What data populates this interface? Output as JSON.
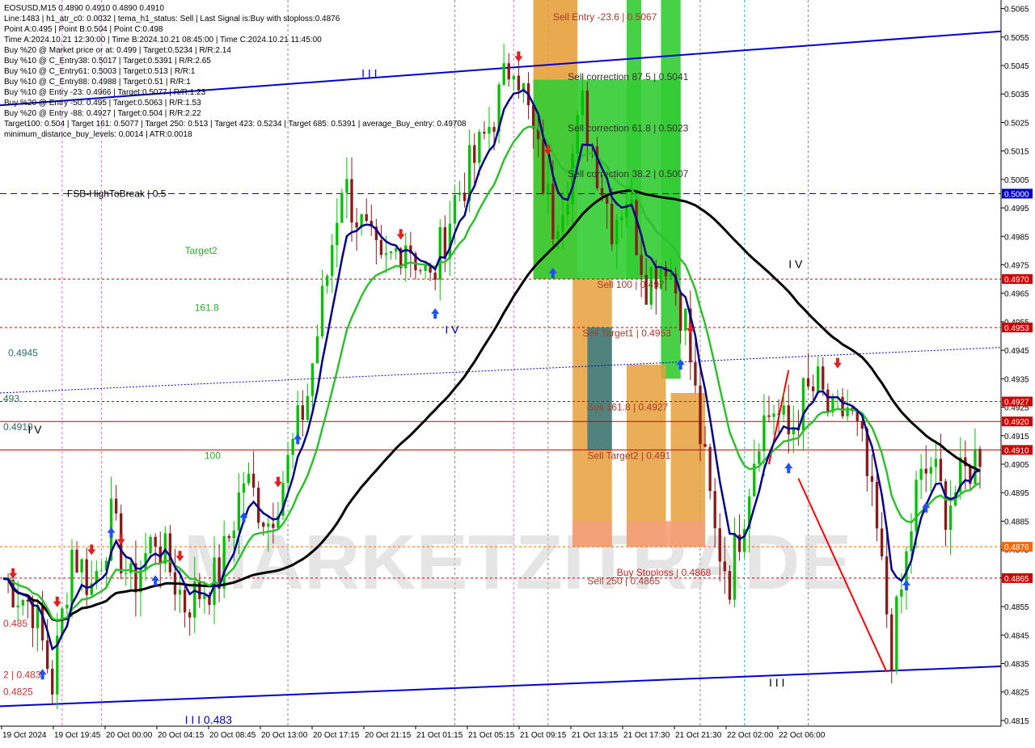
{
  "header": {
    "lines": [
      "EOSUSD,M15  0.4890 0.4910 0.4890 0.4910",
      "Line:1483  |  h1_atr_c0: 0.0032  |  tema_h1_status: Sell  |  Last Signal is:Buy with stoploss:0.4876",
      "Point A:0.495  |  Point B:0.504  |  Point C:0.498",
      "Time A:2024.10.21 12:30:00  |  Time B:2024.10.21 08:45:00  |  Time C:2024.10.21 11:45:00",
      "Buy %20 @ Market price or at: 0.499  |  Target:0.5234  |  R/R:2.14",
      "Buy %10 @ C_Entry38: 0.5017  |  Target:0.5391  |  R/R:2.65",
      "Buy %10 @ C_Entry61: 0.5003  |  Target:0.513  |  R/R:1",
      "Buy %10 @ C_Entry88: 0.4988  |  Target:0.51  |  R/R:1",
      "Buy %10 @ Entry -23: 0.4966  |  Target:0.5077  |  R/R:1.23",
      "Buy %20 @ Entry -50: 0.495  |  Target:0.5063  |  R/R:1.53",
      "Buy %20 @ Entry -88: 0.4927  |  Target:0.504  |  R/R:2.22",
      "Target100: 0.504  |  Target 161: 0.5077  |  Target 250: 0.513  |  Target 423: 0.5234  |  Target 685: 0.5391  |  average_Buy_entry: 0.49708",
      "minimum_distance_buy_levels: 0.0014  |  ATR:0.0018"
    ]
  },
  "watermark": "MARKETZITRADE",
  "colors": {
    "bull": "#00c000",
    "bear": "#8b1a1a",
    "ma_navy": "#00008b",
    "ma_green": "#2ec02e",
    "ma_black": "#000000",
    "channel": "#0000cd",
    "dashed_red": "#cc0000",
    "fsb": "#0000cd",
    "zone_green": "#33cc33",
    "zone_orange": "#e6a03c",
    "zone_teal": "#4a7f80",
    "zone_salmon": "#f4a07a"
  },
  "chart_data": {
    "type": "candlestick",
    "symbol": "EOSUSD",
    "timeframe": "M15",
    "ylim": [
      0.4813,
      0.5068
    ],
    "x_count": 200,
    "time_labels": [
      "19 Oct 2024",
      "19 Oct 19:45",
      "20 Oct 00:00",
      "20 Oct 04:15",
      "20 Oct 08:45",
      "20 Oct 13:00",
      "20 Oct 17:15",
      "20 Oct 21:15",
      "21 Oct 01:15",
      "21 Oct 05:15",
      "21 Oct 09:15",
      "21 Oct 13:15",
      "21 Oct 17:30",
      "21 Oct 21:30",
      "22 Oct 02:00",
      "22 Oct 06:00"
    ],
    "price_ticks": [
      "0.5065",
      "0.5055",
      "0.5045",
      "0.5035",
      "0.5025",
      "0.5015",
      "0.5005",
      "0.4995",
      "0.4985",
      "0.4975",
      "0.4965",
      "0.4955",
      "0.4945",
      "0.4935",
      "0.4925",
      "0.4915",
      "0.4905",
      "0.4895",
      "0.4885",
      "0.4875",
      "0.4865",
      "0.4855",
      "0.4845",
      "0.4835",
      "0.4825",
      "0.4815"
    ],
    "marked_levels": [
      {
        "price": 0.5,
        "label": "0.5000",
        "color": "#0000cd"
      },
      {
        "price": 0.497,
        "label": "0.4970",
        "color": "#cc0000"
      },
      {
        "price": 0.4953,
        "label": "0.4953",
        "color": "#cc0000"
      },
      {
        "price": 0.4927,
        "label": "0.4927",
        "color": "#cc0000"
      },
      {
        "price": 0.492,
        "label": "0.4920",
        "color": "#cc0000"
      },
      {
        "price": 0.491,
        "label": "0.4910",
        "color": "#cc0000"
      },
      {
        "price": 0.4876,
        "label": "0.4876",
        "color": "#ff6600"
      },
      {
        "price": 0.4865,
        "label": "0.4865",
        "color": "#cc0000"
      }
    ],
    "level_labels": [
      {
        "text": "FSB-HighToBreak | 0.5",
        "price": 0.5,
        "x_index": 13,
        "color": "#000000"
      },
      {
        "text": "Sell Entry -23.6 | 0.5067",
        "price": 0.5062,
        "x_index": 112,
        "color": "#a83a2a"
      },
      {
        "text": "Sell correction 87.5 | 0.5041",
        "price": 0.5041,
        "x_index": 115,
        "color": "#333333"
      },
      {
        "text": "Sell correction 61.8 | 0.5023",
        "price": 0.5023,
        "x_index": 115,
        "color": "#333333"
      },
      {
        "text": "Sell correction 38.2 | 0.5007",
        "price": 0.5007,
        "x_index": 115,
        "color": "#333333"
      },
      {
        "text": "Sell 100 | 0.497",
        "price": 0.4968,
        "x_index": 121,
        "color": "#a83a2a"
      },
      {
        "text": "Sell Target1 | 0.4953",
        "price": 0.4951,
        "x_index": 118,
        "color": "#a83a2a"
      },
      {
        "text": "Sell 161.8 | 0.4927",
        "price": 0.4925,
        "x_index": 119,
        "color": "#a83a2a"
      },
      {
        "text": "Sell Target2 | 0.491",
        "price": 0.4908,
        "x_index": 119,
        "color": "#a83a2a"
      },
      {
        "text": "Buy Stoploss | 0.4868",
        "price": 0.4867,
        "x_index": 125,
        "color": "#cc2222"
      },
      {
        "text": "Sell 250 | 0.4865",
        "price": 0.4864,
        "x_index": 119,
        "color": "#a83a2a"
      },
      {
        "text": "Target2",
        "price": 0.498,
        "x_index": 37,
        "color": "#2ea82e"
      },
      {
        "text": "161.8",
        "price": 0.496,
        "x_index": 39,
        "color": "#2ea82e"
      },
      {
        "text": "100",
        "price": 0.4908,
        "x_index": 41,
        "color": "#2ea82e"
      },
      {
        "text": "0.4945",
        "price": 0.4944,
        "x_index": 1,
        "color": "#2e6a6a"
      },
      {
        "text": "493",
        "price": 0.4928,
        "x_index": 0,
        "color": "#2e6a6a"
      },
      {
        "text": "0.4919",
        "price": 0.4918,
        "x_index": 0,
        "color": "#2e6a6a"
      },
      {
        "text": "0.485",
        "price": 0.4849,
        "x_index": 0,
        "color": "#cc3333"
      },
      {
        "text": "2 | 0.483",
        "price": 0.4831,
        "x_index": 0,
        "color": "#cc3333"
      },
      {
        "text": "0.4825",
        "price": 0.4825,
        "x_index": 0,
        "color": "#cc3333"
      }
    ],
    "wave_labels": [
      {
        "text": "I I I",
        "price": 0.5042,
        "x_index": 73,
        "color": "#0000cd"
      },
      {
        "text": "I V",
        "price": 0.4975,
        "x_index": 160,
        "color": "#000000"
      },
      {
        "text": "I V",
        "price": 0.4952,
        "x_index": 90,
        "color": "#0000cd"
      },
      {
        "text": "I V",
        "price": 0.4917,
        "x_index": 5,
        "color": "#000000"
      },
      {
        "text": "I I I",
        "price": 0.4828,
        "x_index": 156,
        "color": "#000000"
      },
      {
        "text": "I I I  0.483",
        "price": 0.4815,
        "x_index": 37,
        "color": "#0000cd"
      }
    ]
  }
}
